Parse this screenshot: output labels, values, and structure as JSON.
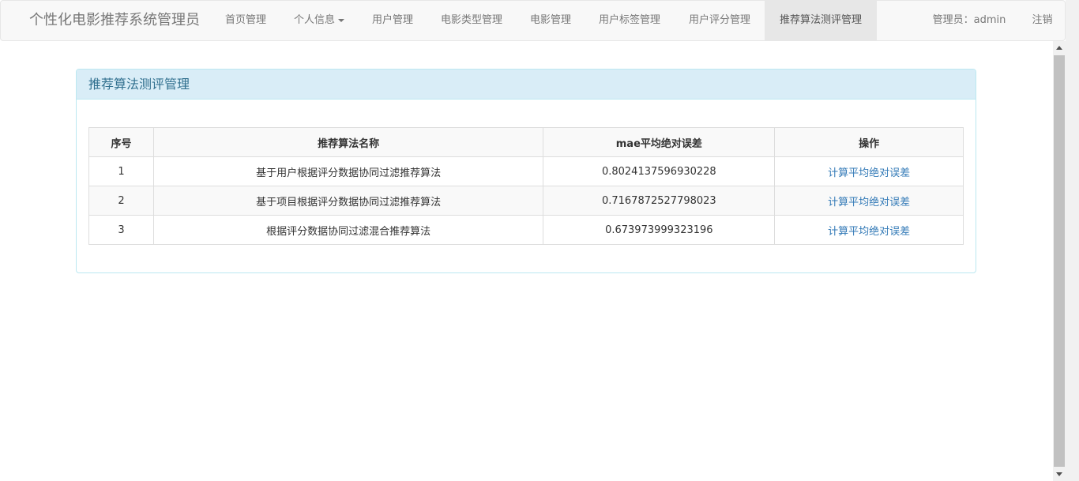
{
  "navbar": {
    "brand": "个性化电影推荐系统管理员",
    "items": [
      {
        "label": "首页管理",
        "active": false,
        "dropdown": false
      },
      {
        "label": "个人信息",
        "active": false,
        "dropdown": true
      },
      {
        "label": "用户管理",
        "active": false,
        "dropdown": false
      },
      {
        "label": "电影类型管理",
        "active": false,
        "dropdown": false
      },
      {
        "label": "电影管理",
        "active": false,
        "dropdown": false
      },
      {
        "label": "用户标签管理",
        "active": false,
        "dropdown": false
      },
      {
        "label": "用户评分管理",
        "active": false,
        "dropdown": false
      },
      {
        "label": "推荐算法测评管理",
        "active": true,
        "dropdown": false
      }
    ],
    "admin_label": "管理员：admin",
    "logout_label": "注销"
  },
  "panel": {
    "title": "推荐算法测评管理"
  },
  "table": {
    "headers": [
      "序号",
      "推荐算法名称",
      "mae平均绝对误差",
      "操作"
    ],
    "rows": [
      {
        "no": "1",
        "name": "基于用户根据评分数据协同过滤推荐算法",
        "mae": "0.8024137596930228",
        "action": "计算平均绝对误差"
      },
      {
        "no": "2",
        "name": "基于项目根据评分数据协同过滤推荐算法",
        "mae": "0.7167872527798023",
        "action": "计算平均绝对误差"
      },
      {
        "no": "3",
        "name": "根据评分数据协同过滤混合推荐算法",
        "mae": "0.673973999323196",
        "action": "计算平均绝对误差"
      }
    ]
  },
  "colors": {
    "navbar_bg": "#f8f8f8",
    "panel_heading_bg": "#d9edf7",
    "panel_heading_text": "#31708f",
    "link": "#337ab7"
  }
}
